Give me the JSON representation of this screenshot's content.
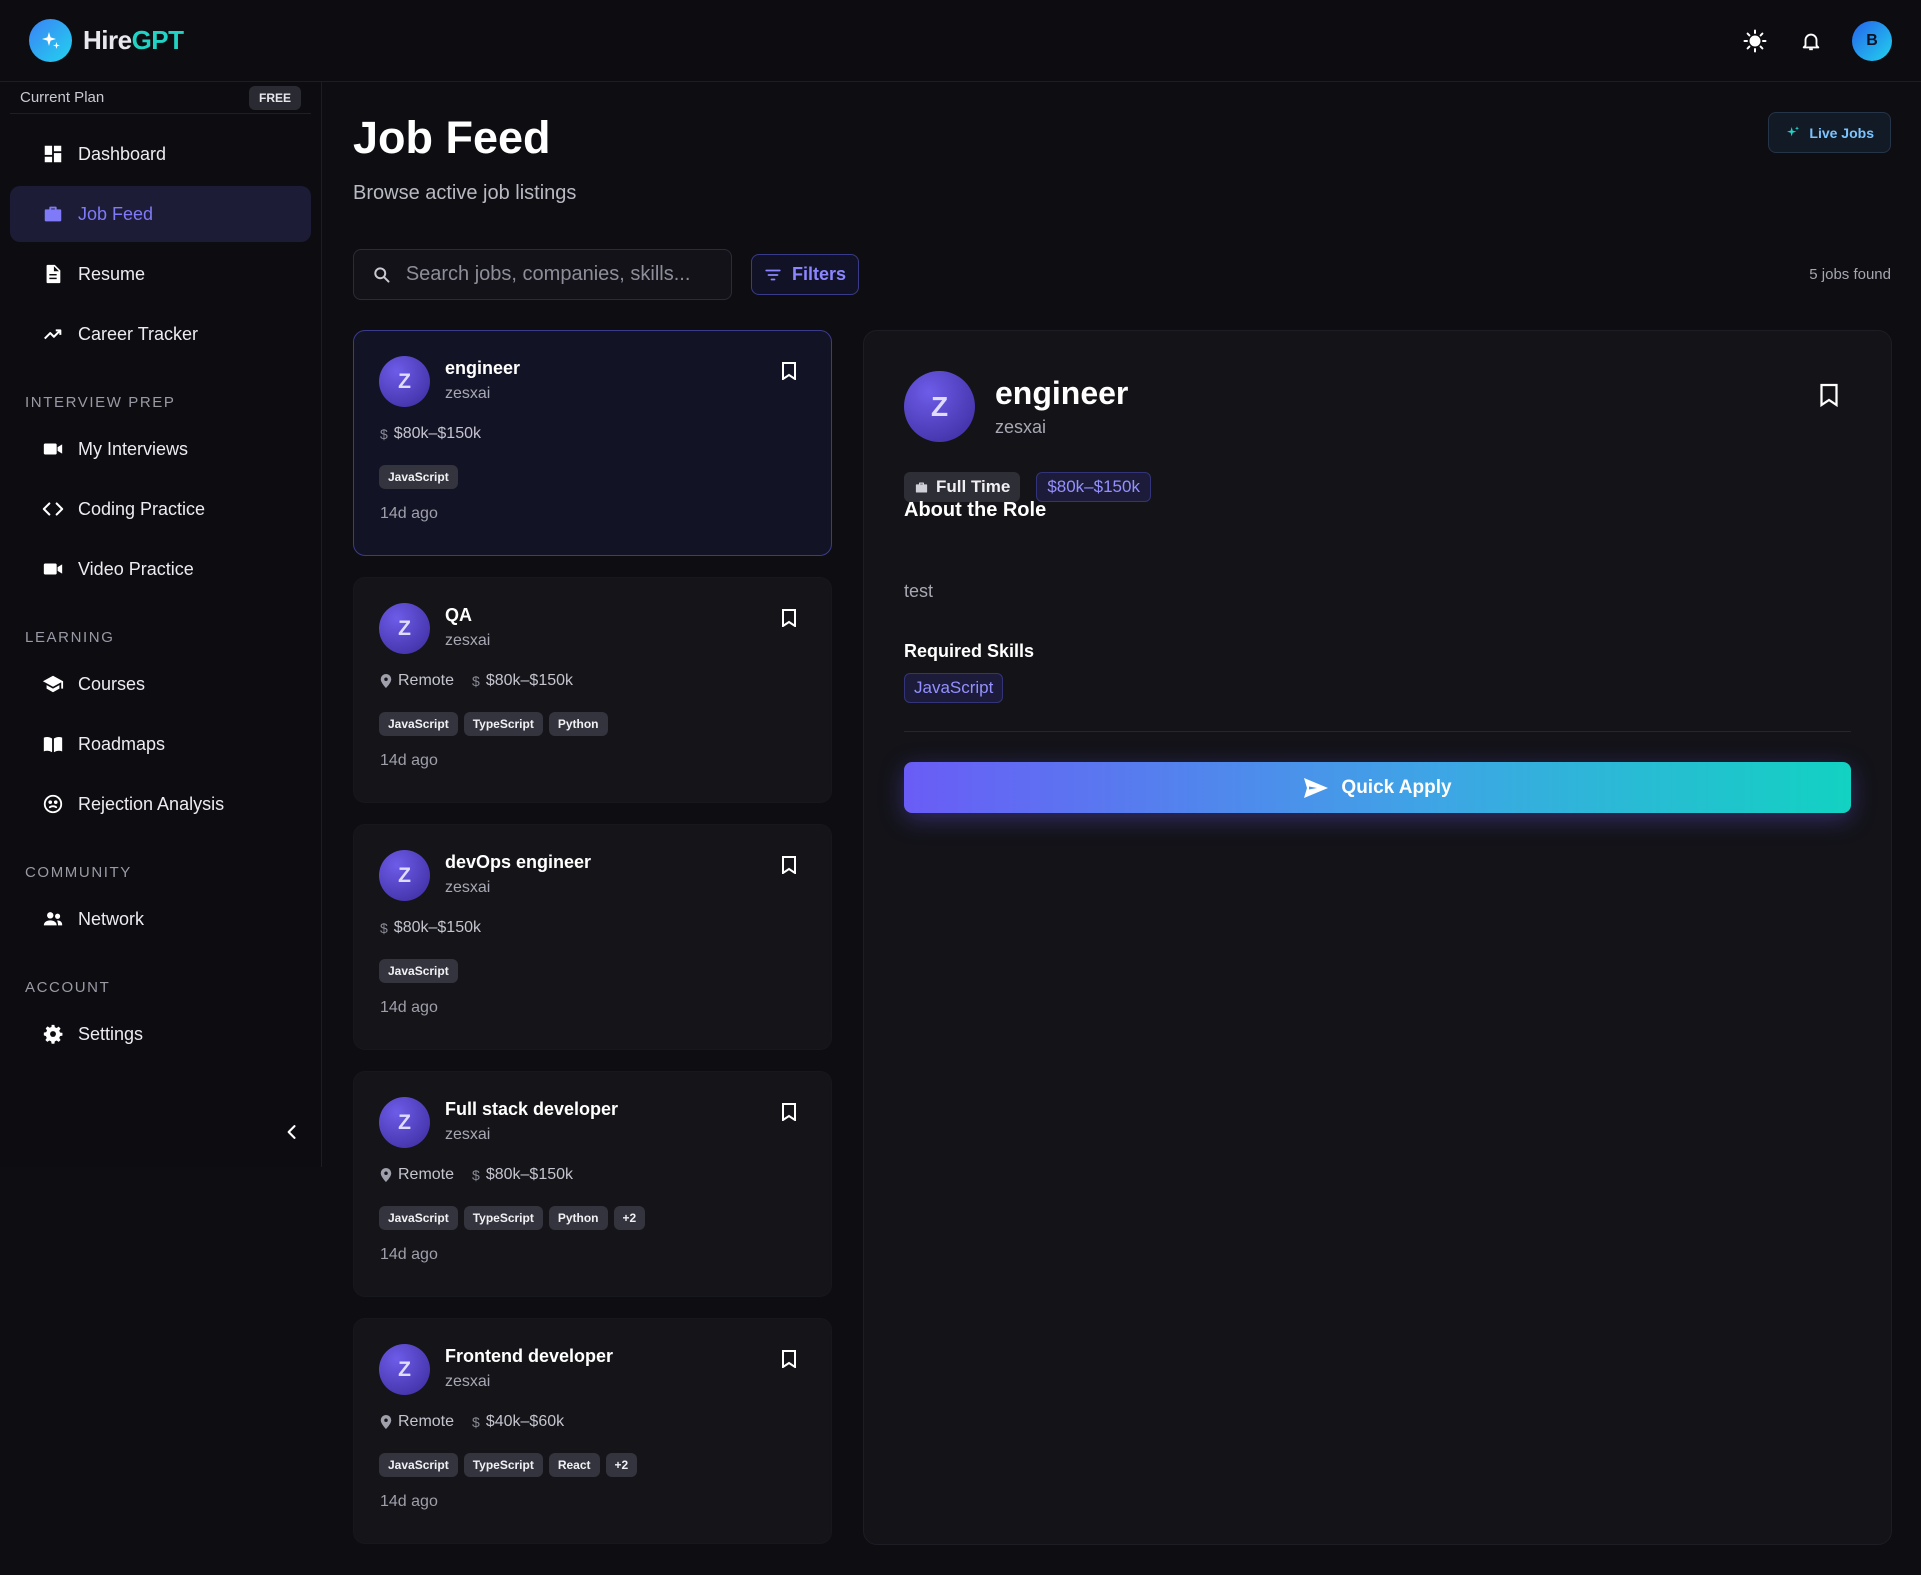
{
  "brand": {
    "name_primary": "Hire",
    "name_accent": "GPT",
    "accent_color": "#22d3c5"
  },
  "header": {
    "theme_icon": "sun-icon",
    "notification_icon": "bell-icon",
    "avatar_initial": "B"
  },
  "sidebar": {
    "plan_label": "Current Plan",
    "plan_badge": "FREE",
    "main_items": [
      {
        "label": "Dashboard",
        "icon": "dashboard-icon"
      },
      {
        "label": "Job Feed",
        "icon": "briefcase-icon",
        "active": true
      },
      {
        "label": "Resume",
        "icon": "document-icon"
      },
      {
        "label": "Career Tracker",
        "icon": "trending-up-icon"
      }
    ],
    "sections": [
      {
        "title": "INTERVIEW PREP",
        "items": [
          {
            "label": "My Interviews",
            "icon": "video-camera-icon"
          },
          {
            "label": "Coding Practice",
            "icon": "code-icon"
          },
          {
            "label": "Video Practice",
            "icon": "video-camera-icon"
          }
        ]
      },
      {
        "title": "LEARNING",
        "items": [
          {
            "label": "Courses",
            "icon": "graduation-cap-icon"
          },
          {
            "label": "Roadmaps",
            "icon": "book-icon"
          },
          {
            "label": "Rejection Analysis",
            "icon": "face-icon"
          }
        ]
      },
      {
        "title": "COMMUNITY",
        "items": [
          {
            "label": "Network",
            "icon": "people-icon"
          }
        ]
      },
      {
        "title": "ACCOUNT",
        "items": [
          {
            "label": "Settings",
            "icon": "gear-icon"
          }
        ]
      }
    ]
  },
  "page": {
    "title": "Job Feed",
    "subtitle": "Browse active job listings",
    "live_jobs_label": "Live Jobs",
    "search_placeholder": "Search jobs, companies, skills...",
    "filters_label": "Filters",
    "jobs_count": "5 jobs found"
  },
  "jobs": [
    {
      "initial": "Z",
      "title": "engineer",
      "company": "zesxai",
      "location": "",
      "salary": "$80k–$150k",
      "tags": [
        "JavaScript"
      ],
      "posted": "14d ago",
      "selected": true
    },
    {
      "initial": "Z",
      "title": "QA",
      "company": "zesxai",
      "location": "Remote",
      "salary": "$80k–$150k",
      "tags": [
        "JavaScript",
        "TypeScript",
        "Python"
      ],
      "posted": "14d ago"
    },
    {
      "initial": "Z",
      "title": "devOps engineer",
      "company": "zesxai",
      "location": "",
      "salary": "$80k–$150k",
      "tags": [
        "JavaScript"
      ],
      "posted": "14d ago"
    },
    {
      "initial": "Z",
      "title": "Full stack developer",
      "company": "zesxai",
      "location": "Remote",
      "salary": "$80k–$150k",
      "tags": [
        "JavaScript",
        "TypeScript",
        "Python",
        "+2"
      ],
      "posted": "14d ago"
    },
    {
      "initial": "Z",
      "title": "Frontend developer",
      "company": "zesxai",
      "location": "Remote",
      "salary": "$40k–$60k",
      "tags": [
        "JavaScript",
        "TypeScript",
        "React",
        "+2"
      ],
      "posted": "14d ago"
    }
  ],
  "detail": {
    "initial": "Z",
    "title": "engineer",
    "company": "zesxai",
    "employment_type": "Full Time",
    "salary": "$80k–$150k",
    "about_heading": "About the Role",
    "description": "test",
    "skills_heading": "Required Skills",
    "skills": [
      "JavaScript"
    ],
    "apply_label": "Quick Apply"
  }
}
